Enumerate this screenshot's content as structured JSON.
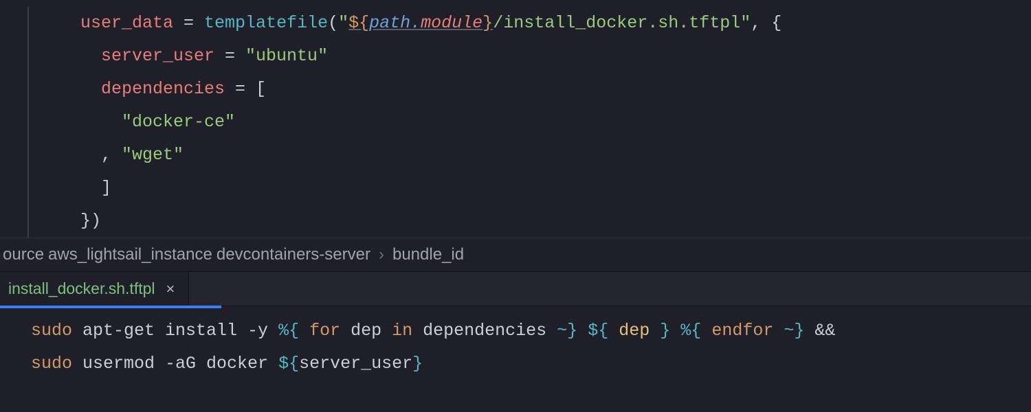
{
  "upper_editor": {
    "lines": {
      "l1": {
        "prop": "user_data",
        "eq": " = ",
        "fn": "templatefile",
        "open": "(",
        "q1": "\"",
        "interp_open": "${",
        "path_ns": "path",
        "dot": ".",
        "path_attr": "module",
        "interp_close": "}",
        "rest": "/install_docker.sh.tftpl",
        "q2": "\"",
        "comma_brace": ", {"
      },
      "l2": {
        "prop": "server_user",
        "eq": " = ",
        "val": "\"ubuntu\""
      },
      "l3": {
        "prop": "dependencies",
        "eq": " = ",
        "bracket": "["
      },
      "l4": {
        "val": "\"docker-ce\""
      },
      "l5": {
        "comma": ",",
        "val": " \"wget\""
      },
      "l6": {
        "bracket": "]"
      },
      "l7": {
        "close": "})"
      }
    }
  },
  "breadcrumb": {
    "seg1": "ource",
    "seg2": "aws_lightsail_instance",
    "seg3": "devcontainers-server",
    "sep": "›",
    "seg4": "bundle_id"
  },
  "tab": {
    "filename": "install_docker.sh.tftpl",
    "close_glyph": "×"
  },
  "lower_editor": {
    "line1": {
      "sudo": "sudo",
      "apt": " apt-get install -y ",
      "pct_open1": "%{",
      "for": " for ",
      "dep1": "dep",
      "in": " in ",
      "deps": "dependencies",
      "tilde_close1": " ~}",
      "sp1": " ",
      "dollar_open": "${",
      "sp2": " ",
      "dep2": "dep",
      "sp3": " ",
      "dollar_close": "}",
      "sp4": " ",
      "pct_open2": "%{",
      "endfor": " endfor ",
      "tilde_close2": "~}",
      "andand": " &&"
    },
    "line2": {
      "sudo": "sudo",
      "usermod": " usermod -aG docker ",
      "dollar_open": "${",
      "var": "server_user",
      "dollar_close": "}"
    }
  }
}
